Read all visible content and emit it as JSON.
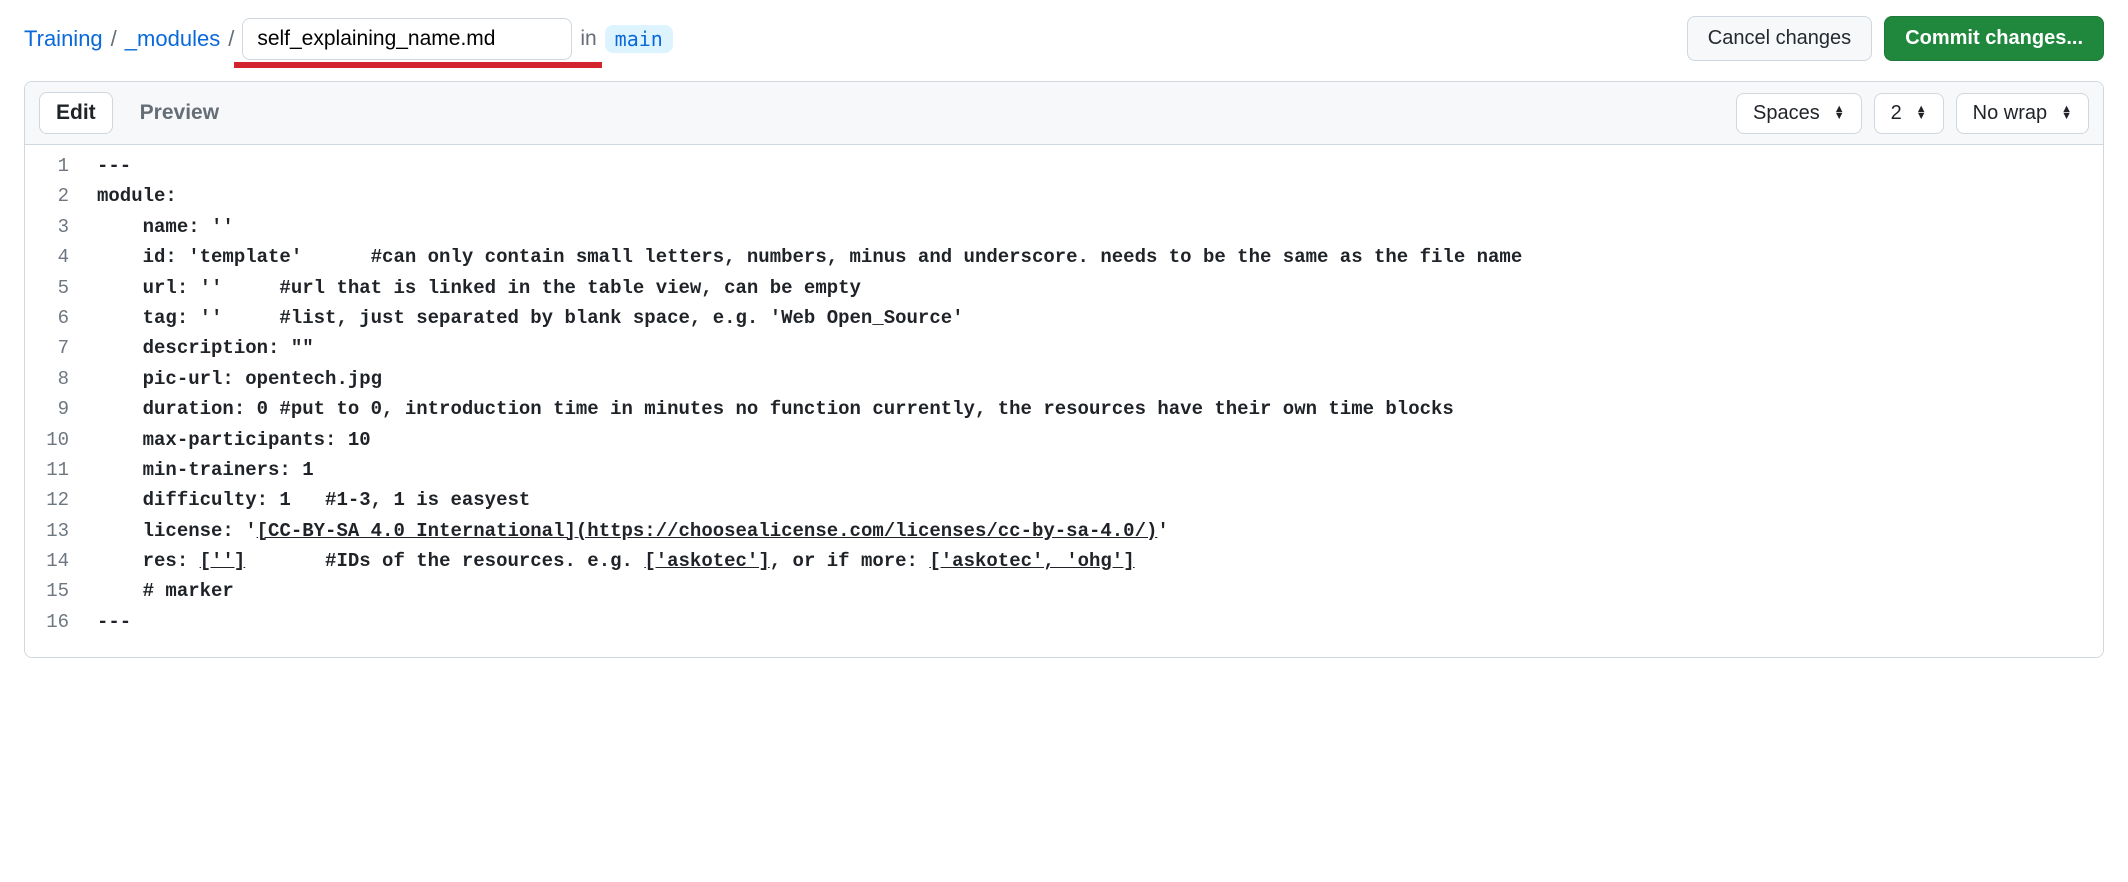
{
  "breadcrumb": {
    "root": "Training",
    "sep": "/",
    "folder": "_modules",
    "filename_value": "self_explaining_name.md",
    "in_label": "in",
    "branch": "main",
    "accent_color": "#d1242f"
  },
  "actions": {
    "cancel": "Cancel changes",
    "commit": "Commit changes..."
  },
  "tabs": {
    "edit": "Edit",
    "preview": "Preview"
  },
  "settings": {
    "indent": "Spaces",
    "width": "2",
    "wrap": "No wrap"
  },
  "code": {
    "lines": [
      "---",
      "module:",
      "    name: ''",
      "    id: 'template'      #can only contain small letters, numbers, minus and underscore. needs to be the same as the file name",
      "    url: ''     #url that is linked in the table view, can be empty",
      "    tag: ''     #list, just separated by blank space, e.g. 'Web Open_Source'",
      "    description: \"\"",
      "    pic-url: opentech.jpg",
      "    duration: 0 #put to 0, introduction time in minutes no function currently, the resources have their own time blocks",
      "    max-participants: 10",
      "    min-trainers: 1",
      "    difficulty: 1   #1-3, 1 is easyest",
      "    license: '[CC-BY-SA 4.0 International](https://choosealicense.com/licenses/cc-by-sa-4.0/)'",
      "    res: ['']       #IDs of the resources. e.g. ['askotec'], or if more: ['askotec', 'ohg']",
      "    # marker",
      "---"
    ]
  }
}
